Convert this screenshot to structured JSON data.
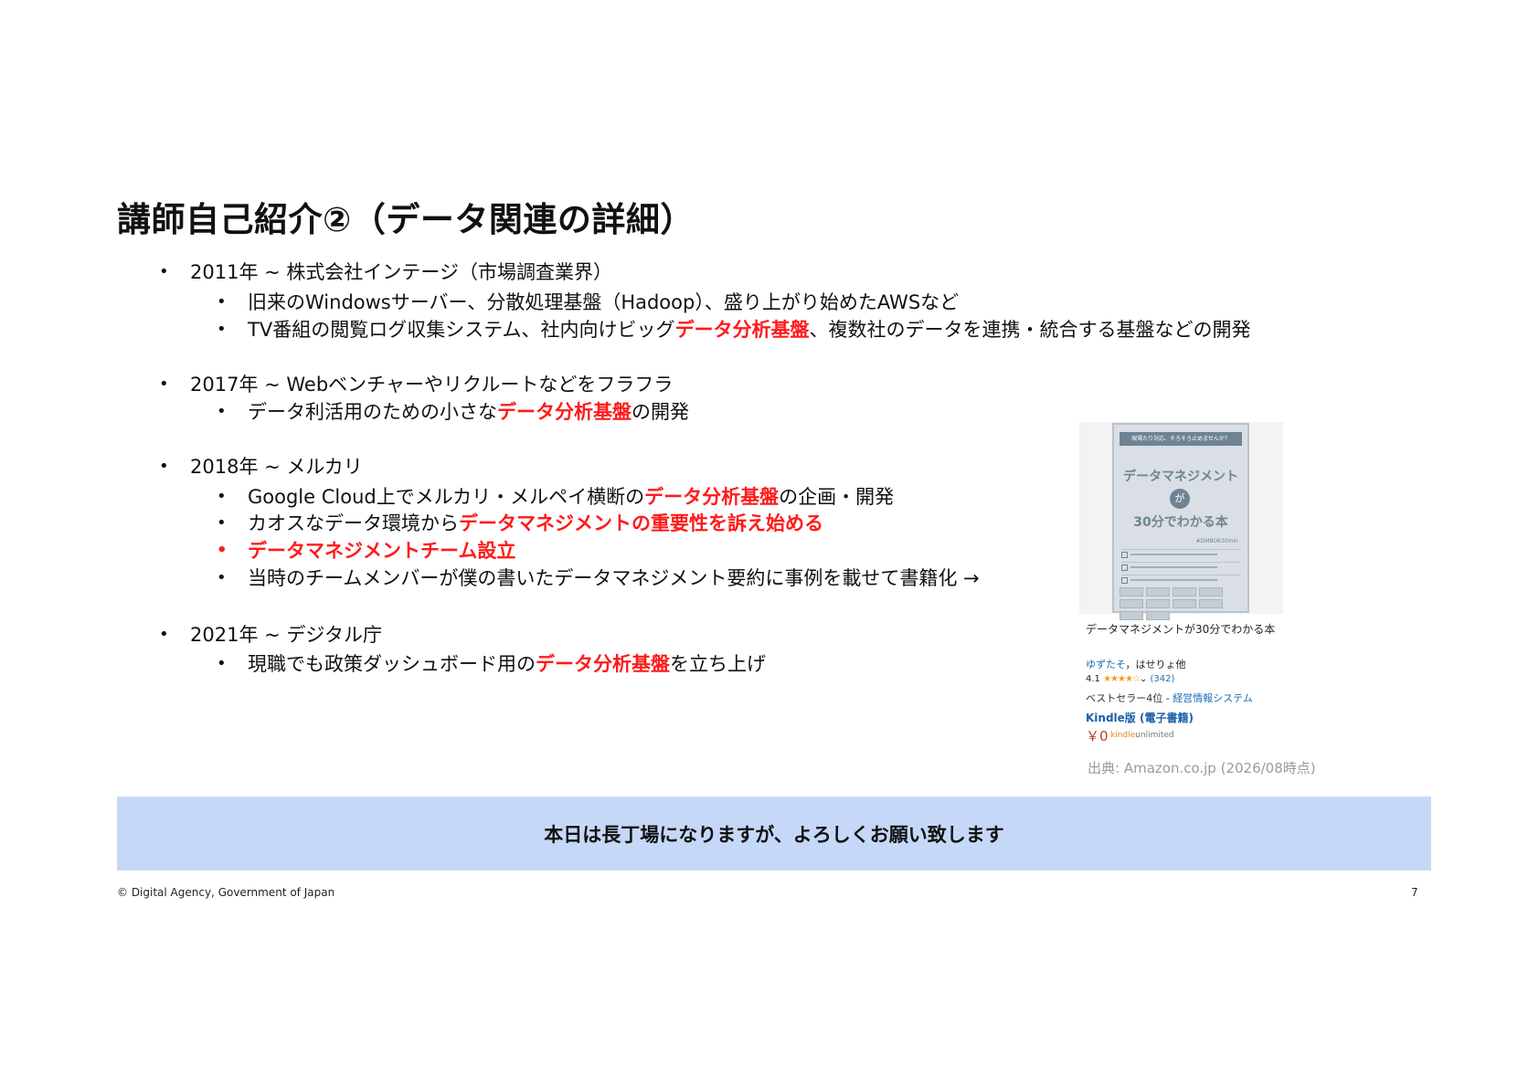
{
  "slide": {
    "title": "講師自己紹介②（データ関連の詳細）",
    "bullet_glyph": "•",
    "sections": [
      {
        "heading": "2011年 ~ 株式会社インテージ（市場調査業界）",
        "items": [
          {
            "before": " 旧来のWindowsサーバー、分散処理基盤（Hadoop）、盛り上がり始めたAWSなど",
            "highlight": "",
            "after": ""
          },
          {
            "before": "TV番組の閲覧ログ収集システム、社内向けビッグ",
            "highlight": "データ分析基盤",
            "after": "、複数社のデータを連携・統合する基盤などの開発"
          }
        ]
      },
      {
        "heading": "2017年 ~ Webベンチャーやリクルートなどをフラフラ",
        "items": [
          {
            "before": "データ利活用のための小さな",
            "highlight": "データ分析基盤",
            "after": "の開発"
          }
        ]
      },
      {
        "heading": "2018年 ~ メルカリ",
        "items": [
          {
            "before": "Google Cloud上でメルカリ・メルペイ横断の",
            "highlight": "データ分析基盤",
            "after": "の企画・開発"
          },
          {
            "before": "カオスなデータ環境から",
            "highlight": "データマネジメントの重要性を訴え始める",
            "after": ""
          },
          {
            "before": "",
            "highlight": "データマネジメントチーム設立",
            "after": ""
          },
          {
            "before": "当時のチームメンバーが僕の書いたデータマネジメント要約に事例を載せて書籍化 →",
            "highlight": "",
            "after": ""
          }
        ]
      },
      {
        "heading": "2021年 ~ デジタル庁",
        "items": [
          {
            "before": "現職でも政策ダッシュボード用の",
            "highlight": "データ分析基盤",
            "after": "を立ち上げ"
          }
        ]
      }
    ]
  },
  "book": {
    "title": "データマネジメントが30分でわかる本",
    "author_link": "ゆずたそ",
    "author_rest": "，はせりょ他",
    "rating": "4.1",
    "stars": "★★★★☆",
    "review_count": "(342)",
    "rank_text": "ベストセラー4位 - ",
    "rank_category": "経営情報システム",
    "format": "Kindle版 (電子書籍)",
    "price": "￥0",
    "kindle_word": "kindle",
    "unlimited_word": "unlimited",
    "cover_band": "現場たり対応、そろそろ止めませんか？",
    "cover_title_1": "データマネジメント",
    "cover_ga": "が",
    "cover_title_2": "30分でわかる本",
    "cover_tag": "#DMBOK30min"
  },
  "source": "出典: Amazon.co.jp (2026/08時点)",
  "banner": "本日は長丁場になりますが、よろしくお願い致します",
  "footer": {
    "copyright": "© Digital Agency, Government of Japan",
    "page_number": "7"
  },
  "colors": {
    "highlight": "#ff1a1a",
    "banner_bg": "#c6d8f7",
    "link": "#1a6fb4"
  }
}
